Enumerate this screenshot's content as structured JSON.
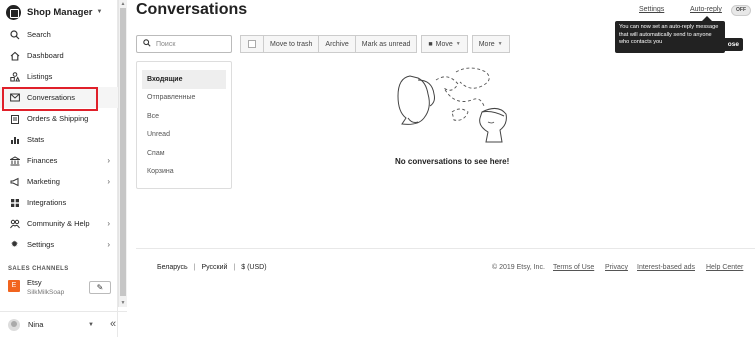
{
  "sidebar": {
    "brand": "Shop Manager",
    "items": [
      {
        "label": "Search",
        "icon": "search-icon"
      },
      {
        "label": "Dashboard",
        "icon": "home-icon"
      },
      {
        "label": "Listings",
        "icon": "shapes-icon"
      },
      {
        "label": "Conversations",
        "icon": "mail-icon",
        "active": true
      },
      {
        "label": "Orders & Shipping",
        "icon": "clipboard-icon"
      },
      {
        "label": "Stats",
        "icon": "bar-chart-icon"
      },
      {
        "label": "Finances",
        "icon": "bank-icon",
        "expandable": true
      },
      {
        "label": "Marketing",
        "icon": "megaphone-icon",
        "expandable": true
      },
      {
        "label": "Integrations",
        "icon": "grid-icon"
      },
      {
        "label": "Community & Help",
        "icon": "people-icon",
        "expandable": true
      },
      {
        "label": "Settings",
        "icon": "gear-icon",
        "expandable": true
      }
    ],
    "channels_title": "SALES CHANNELS",
    "channel": {
      "badge": "E",
      "name": "Etsy",
      "shop": "SilkMilkSoap"
    },
    "user": {
      "name": "Nina"
    }
  },
  "header": {
    "title": "Conversations",
    "settings_link": "Settings",
    "autoreply_link": "Auto-reply",
    "toggle_label": "OFF"
  },
  "tooltip": {
    "text": "You can now set an auto-reply message that will automatically send to anyone who contacts you",
    "close_label": "ose"
  },
  "search": {
    "placeholder": "Поиск"
  },
  "toolbar": {
    "move_to_trash": "Move to trash",
    "archive": "Archive",
    "mark_unread": "Mark as unread",
    "move": "Move",
    "more": "More"
  },
  "folders": [
    {
      "label": "Входящие",
      "selected": true
    },
    {
      "label": "Отправленные"
    },
    {
      "label": "Все"
    },
    {
      "label": "Unread"
    },
    {
      "label": "Спам"
    },
    {
      "label": "Корзина"
    }
  ],
  "empty_message": "No conversations to see here!",
  "footer": {
    "region": "Беларусь",
    "language": "Русский",
    "currency": "$ (USD)",
    "copyright": "© 2019 Etsy, Inc.",
    "terms": "Terms of Use",
    "privacy": "Privacy",
    "ads": "Interest-based ads",
    "help": "Help Center"
  },
  "colors": {
    "highlight_border": "#e0202a",
    "etsy_orange": "#f1641e"
  }
}
